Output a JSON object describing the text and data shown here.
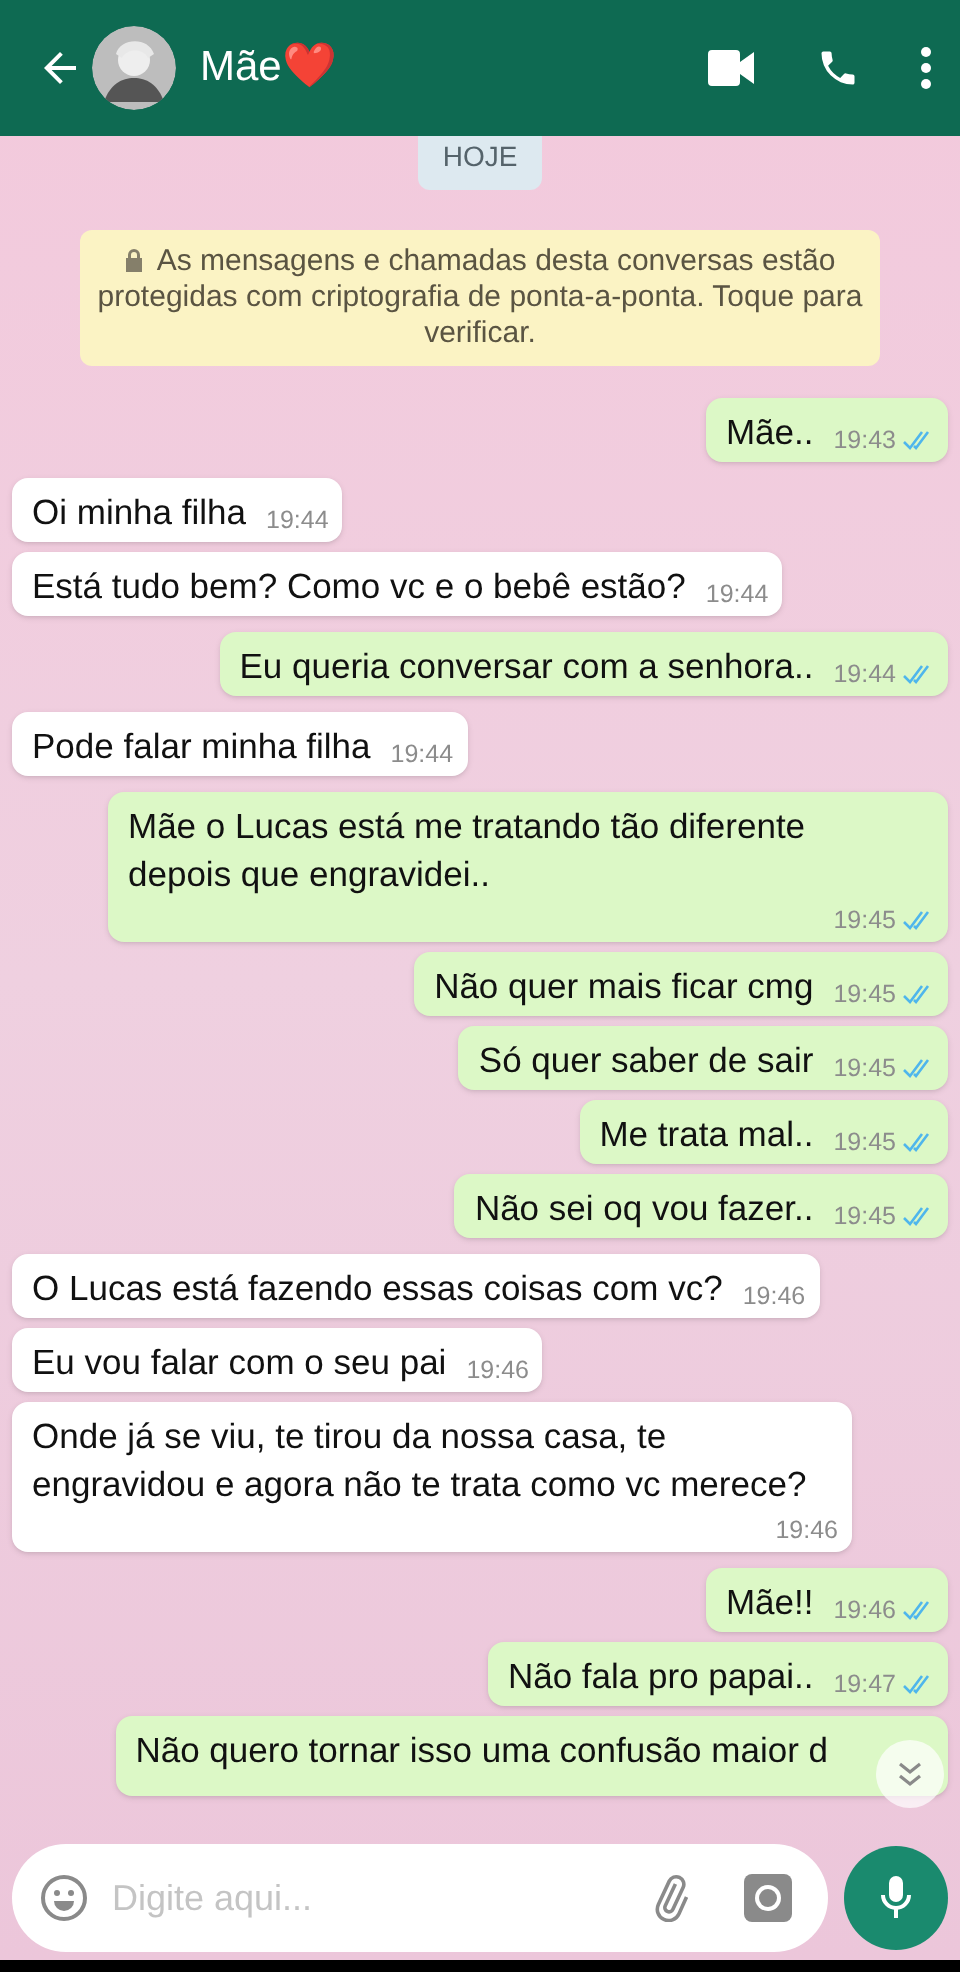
{
  "header": {
    "title": "Mãe",
    "title_emoji": "❤️"
  },
  "date_chip": "HOJE",
  "encryption_notice": "As mensagens e chamadas desta conversas estão protegidas com criptografia de ponta-a-ponta. Toque para verificar.",
  "messages": [
    {
      "kind": "out",
      "text": "Mãe..",
      "time": "19:43",
      "read": true
    },
    {
      "kind": "in",
      "text": "Oi minha filha",
      "time": "19:44"
    },
    {
      "kind": "in",
      "text": "Está tudo bem? Como vc e o bebê estão?",
      "time": "19:44"
    },
    {
      "kind": "out",
      "text": "Eu queria conversar com a senhora..",
      "time": "19:44",
      "read": true
    },
    {
      "kind": "in",
      "text": "Pode falar minha filha",
      "time": "19:44"
    },
    {
      "kind": "out",
      "text": "Mãe o Lucas está me tratando tão diferente depois que engravidei..",
      "time": "19:45",
      "read": true
    },
    {
      "kind": "out",
      "text": "Não quer mais ficar cmg",
      "time": "19:45",
      "read": true
    },
    {
      "kind": "out",
      "text": "Só quer saber de sair",
      "time": "19:45",
      "read": true
    },
    {
      "kind": "out",
      "text": "Me trata mal..",
      "time": "19:45",
      "read": true
    },
    {
      "kind": "out",
      "text": "Não sei oq vou fazer..",
      "time": "19:45",
      "read": true
    },
    {
      "kind": "in",
      "text": "O Lucas está fazendo essas coisas com vc?",
      "time": "19:46"
    },
    {
      "kind": "in",
      "text": "Eu vou falar com o seu pai",
      "time": "19:46"
    },
    {
      "kind": "in",
      "text": "Onde já se viu, te tirou da nossa casa, te engravidou e agora não te trata como vc merece?",
      "time": "19:46"
    },
    {
      "kind": "out",
      "text": "Mãe!!",
      "time": "19:46",
      "read": true
    },
    {
      "kind": "out",
      "text": "Não fala pro papai..",
      "time": "19:47",
      "read": true
    },
    {
      "kind": "out",
      "text": "Não quero tornar isso uma confusão maior d"
    }
  ],
  "composer": {
    "placeholder": "Digite aqui..."
  }
}
